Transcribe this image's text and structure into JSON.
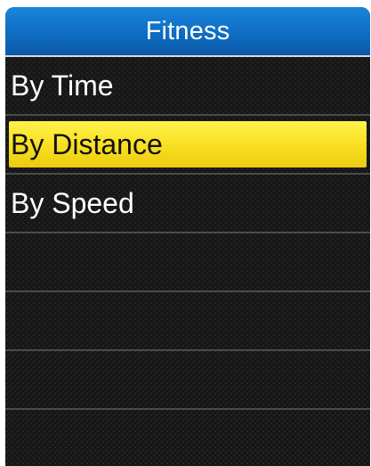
{
  "header": {
    "title": "Fitness"
  },
  "menu": {
    "items": [
      {
        "label": "By Time",
        "selected": false
      },
      {
        "label": "By Distance",
        "selected": true
      },
      {
        "label": "By Speed",
        "selected": false
      },
      {
        "label": "",
        "selected": false
      },
      {
        "label": "",
        "selected": false
      },
      {
        "label": "",
        "selected": false
      }
    ]
  },
  "colors": {
    "title_bar": "#0f6dc2",
    "highlight": "#f7dc1c",
    "background": "#171717"
  }
}
